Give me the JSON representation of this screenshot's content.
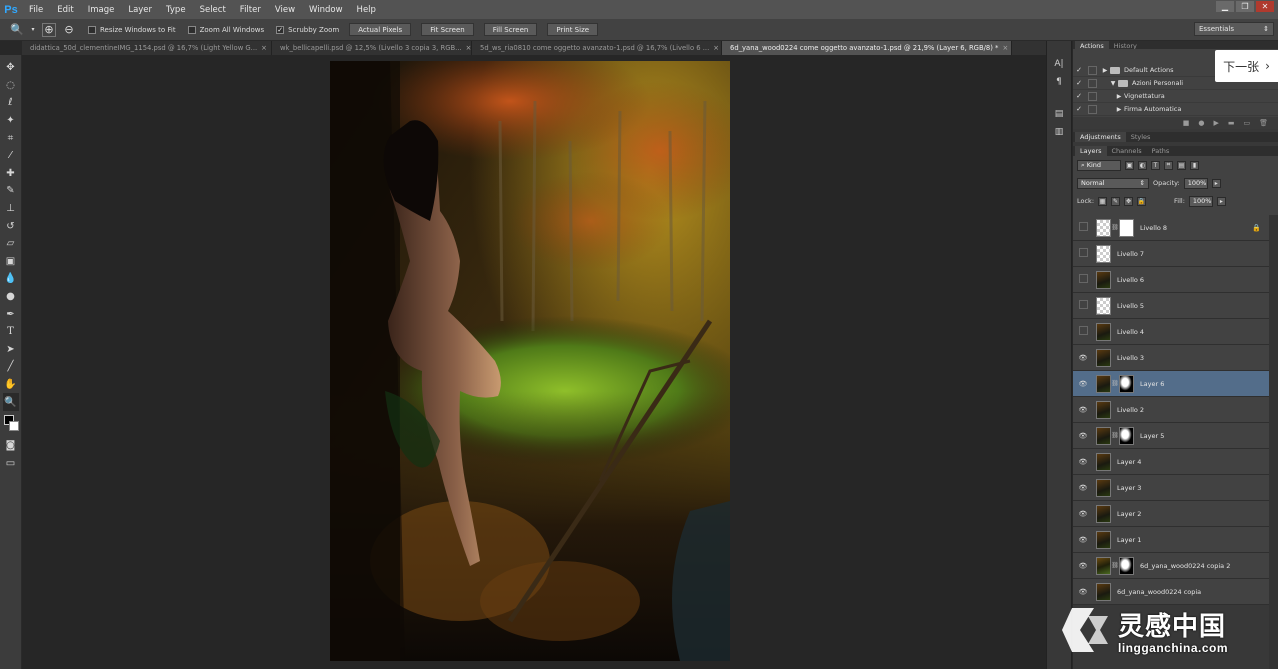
{
  "app": {
    "logo": "Ps"
  },
  "menu": [
    "File",
    "Edit",
    "Image",
    "Layer",
    "Type",
    "Select",
    "Filter",
    "View",
    "Window",
    "Help"
  ],
  "window_controls": {
    "minimize": "▁",
    "restore": "❐",
    "close": "✕"
  },
  "options": {
    "resize_windows": "Resize Windows to Fit",
    "zoom_all": "Zoom All Windows",
    "scrubby_zoom": "Scrubby Zoom",
    "actual_pixels": "Actual Pixels",
    "fit_screen": "Fit Screen",
    "fill_screen": "Fill Screen",
    "print_size": "Print Size",
    "workspace": "Essentials"
  },
  "tabs": [
    {
      "label": "didattica_50d_clementineIMG_1154.psd @ 16,7% (Light Yellow G..."
    },
    {
      "label": "wk_bellicapelli.psd @ 12,5% (Livello 3 copia 3, RGB..."
    },
    {
      "label": "5d_ws_ria0810 come oggetto avanzato-1.psd @ 16,7% (Livello 6 ..."
    },
    {
      "label": "6d_yana_wood0224 come oggetto avanzato-1.psd @ 21,9% (Layer 6, RGB/8) *"
    }
  ],
  "actions_panel": {
    "tabs": [
      "Actions",
      "History"
    ],
    "items": [
      {
        "label": "Default Actions",
        "type": "folder",
        "expanded": false
      },
      {
        "label": "Azioni Personali",
        "type": "folder",
        "expanded": true
      },
      {
        "label": "Vignettatura",
        "type": "action"
      },
      {
        "label": "Firma Automatica",
        "type": "action"
      }
    ]
  },
  "adjustments_tabs": [
    "Adjustments",
    "Styles"
  ],
  "layers_panel": {
    "tabs": [
      "Layers",
      "Channels",
      "Paths"
    ],
    "filter_kind": "Kind",
    "blend_mode": "Normal",
    "opacity_label": "Opacity:",
    "opacity": "100%",
    "lock_label": "Lock:",
    "fill_label": "Fill:",
    "fill": "100%",
    "layers": [
      {
        "name": "Livello 8",
        "visible": false,
        "thumb": "trans",
        "mask": "white",
        "locked": true
      },
      {
        "name": "Livello 7",
        "visible": false,
        "thumb": "trans"
      },
      {
        "name": "Livello 6",
        "visible": false,
        "thumb": "photo"
      },
      {
        "name": "Livello 5",
        "visible": false,
        "thumb": "trans"
      },
      {
        "name": "Livello 4",
        "visible": false,
        "thumb": "photo"
      },
      {
        "name": "Livello 3",
        "visible": true,
        "thumb": "photo"
      },
      {
        "name": "Layer 6",
        "visible": true,
        "thumb": "photo",
        "mask": "fig",
        "selected": true
      },
      {
        "name": "Livello 2",
        "visible": true,
        "thumb": "photo"
      },
      {
        "name": "Layer 5",
        "visible": true,
        "thumb": "photo",
        "mask": "fig"
      },
      {
        "name": "Layer 4",
        "visible": true,
        "thumb": "photo"
      },
      {
        "name": "Layer 3",
        "visible": true,
        "thumb": "photo"
      },
      {
        "name": "Layer 2",
        "visible": true,
        "thumb": "photo"
      },
      {
        "name": "Layer 1",
        "visible": true,
        "thumb": "photo"
      },
      {
        "name": "6d_yana_wood0224 copia 2",
        "visible": true,
        "thumb": "photo2",
        "mask": "fig"
      },
      {
        "name": "6d_yana_wood0224 copia",
        "visible": true,
        "thumb": "photo"
      }
    ]
  },
  "overlay": {
    "next_label": "下一张",
    "watermark_cn": "灵感中国",
    "watermark_url": "lingganchina.com"
  }
}
